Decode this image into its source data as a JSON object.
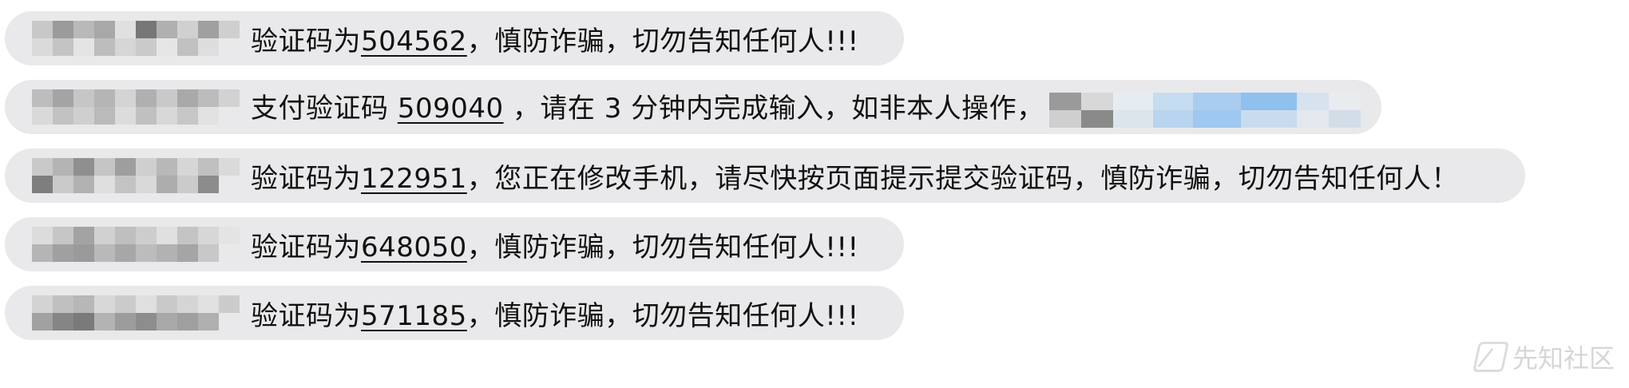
{
  "messages": [
    {
      "prefix": "验证码为",
      "code": "504562",
      "suffix": "，慎防诈骗，切勿告知任何人!!!"
    },
    {
      "prefix": "支付验证码 ",
      "code": "509040",
      "suffix": " ，请在 3 分钟内完成输入，如非本人操作，"
    },
    {
      "prefix": "验证码为",
      "code": "122951",
      "suffix": "，您正在修改手机，请尽快按页面提示提交验证码，慎防诈骗，切勿告知任何人！"
    },
    {
      "prefix": "验证码为",
      "code": "648050",
      "suffix": "，慎防诈骗，切勿告知任何人!!!"
    },
    {
      "prefix": "验证码为",
      "code": "571185",
      "suffix": "，慎防诈骗，切勿告知任何人!!!"
    }
  ],
  "watermark": {
    "text": "先知社区",
    "icon": "xianzhi-logo-icon"
  },
  "colors": {
    "bubble": "#e9e9eb",
    "text": "#111111",
    "watermark": "#d6d6d6"
  }
}
